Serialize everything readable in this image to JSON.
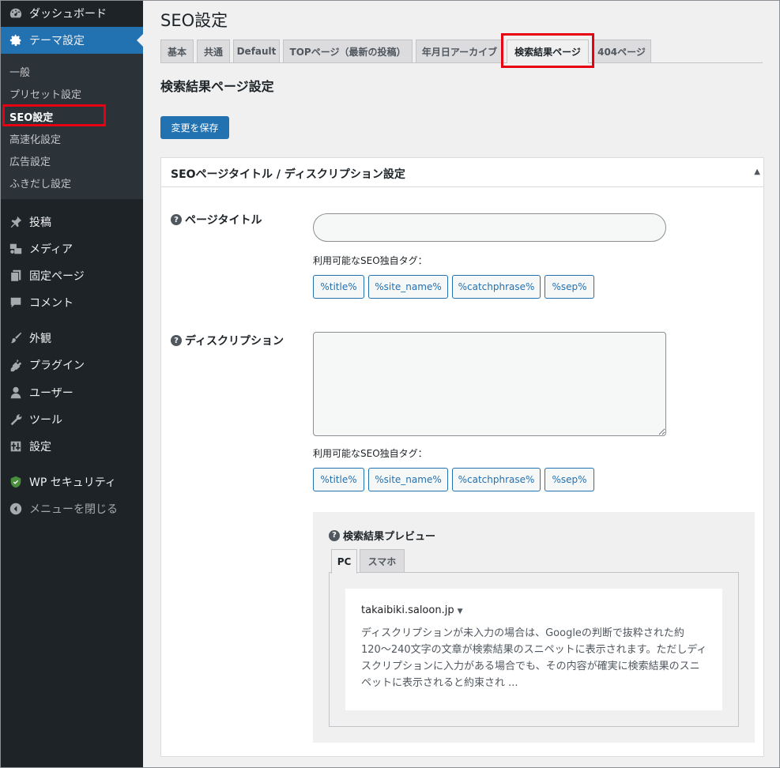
{
  "sidebar": {
    "items": [
      {
        "label": "ダッシュボード",
        "icon": "dashboard-icon"
      },
      {
        "label": "テーマ設定",
        "icon": "gear-icon"
      },
      {
        "label": "投稿",
        "icon": "pushpin-icon"
      },
      {
        "label": "メディア",
        "icon": "media-icon"
      },
      {
        "label": "固定ページ",
        "icon": "page-icon"
      },
      {
        "label": "コメント",
        "icon": "comment-icon"
      },
      {
        "label": "外観",
        "icon": "brush-icon"
      },
      {
        "label": "プラグイン",
        "icon": "plugin-icon"
      },
      {
        "label": "ユーザー",
        "icon": "user-icon"
      },
      {
        "label": "ツール",
        "icon": "wrench-icon"
      },
      {
        "label": "設定",
        "icon": "settings-icon"
      },
      {
        "label": "WP セキュリティ",
        "icon": "shield-icon"
      },
      {
        "label": "メニューを閉じる",
        "icon": "collapse-arrow-icon"
      }
    ],
    "submenu": [
      "一般",
      "プリセット設定",
      "SEO設定",
      "高速化設定",
      "広告設定",
      "ふきだし設定"
    ]
  },
  "header": {
    "title": "SEO設定"
  },
  "tabs": [
    "基本",
    "共通",
    "Default",
    "TOPページ（最新の投稿）",
    "年月日アーカイブ",
    "検索結果ページ",
    "404ページ"
  ],
  "active_tab": "検索結果ページ",
  "section_heading": "検索結果ページ設定",
  "save_button": "変更を保存",
  "panel": {
    "title": "SEOページタイトル / ディスクリプション設定",
    "toggle": "▲",
    "title_label": "ページタイトル",
    "title_value": "",
    "desc_label": "ディスクリプション",
    "desc_value": "",
    "tags_caption": "利用可能なSEO独自タグ：",
    "tags": [
      "%title%",
      "%site_name%",
      "%catchphrase%",
      "%sep%"
    ]
  },
  "preview": {
    "label": "検索結果プレビュー",
    "tabs": [
      "PC",
      "スマホ"
    ],
    "url": "takaibiki.saloon.jp",
    "caret": "▼",
    "description": "ディスクリプションが未入力の場合は、Googleの判断で抜粋された約120〜240文字の文章が検索結果のスニペットに表示されます。ただしディスクリプションに入力がある場合でも、その内容が確実に検索結果のスニペットに表示されると約束され ..."
  },
  "help_icon": "?",
  "colors": {
    "accent": "#2271b1",
    "sidebar": "#1d2327",
    "highlight": "#e60012"
  }
}
